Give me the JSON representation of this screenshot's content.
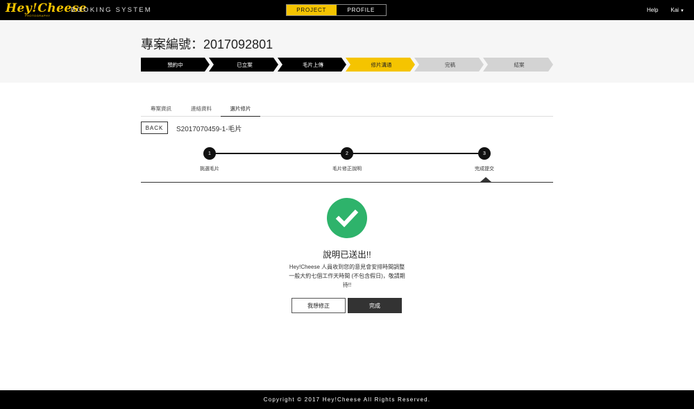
{
  "brand": {
    "logo_text": "Hey!Cheese",
    "logo_sub": "PHOTOGRAPHY",
    "system_title": "BOOKING SYSTEM"
  },
  "top_tabs": [
    {
      "label": "PROJECT",
      "active": true
    },
    {
      "label": "PROFILE",
      "active": false
    }
  ],
  "top_right": {
    "help_label": "Help",
    "user_label": "Kai"
  },
  "project": {
    "title": "專案編號：2017092801"
  },
  "status_steps": [
    {
      "label": "預約中",
      "state": "done"
    },
    {
      "label": "已立案",
      "state": "done"
    },
    {
      "label": "毛片上傳",
      "state": "done"
    },
    {
      "label": "修片溝通",
      "state": "current"
    },
    {
      "label": "完稿",
      "state": "pending"
    },
    {
      "label": "結案",
      "state": "pending"
    }
  ],
  "colors": {
    "accent": "#f5c400",
    "done": "#000000",
    "pending": "#d3d3d3",
    "success": "#2eb36b"
  },
  "sub_tabs": [
    {
      "label": "專案資訊",
      "active": false
    },
    {
      "label": "連絡資料",
      "active": false
    },
    {
      "label": "選片修片",
      "active": true
    }
  ],
  "back_label": "BACK",
  "photo_id": "S2017070459-1-毛片",
  "progress_steps": [
    {
      "number": "1",
      "label": "挑選毛片"
    },
    {
      "number": "2",
      "label": "毛片修正說明"
    },
    {
      "number": "3",
      "label": "完成提交"
    }
  ],
  "success": {
    "icon": "check-icon",
    "title": "說明已送出!!",
    "message": "Hey!Cheese 人員收到您的意見會安排時間調整一般大約七個工作天時間 (不包含假日)，敬請期待!!",
    "revise_label": "我想修正",
    "done_label": "完成"
  },
  "footer": {
    "copyright": "Copyright © 2017 Hey!Cheese All Rights Reserved."
  }
}
